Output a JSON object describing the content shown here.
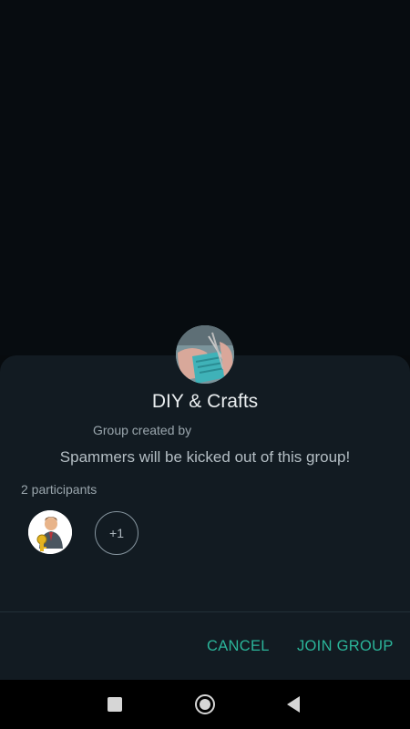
{
  "group": {
    "title": "DIY & Crafts",
    "created_by": "Group created by",
    "description": "Spammers will be kicked out of this group!",
    "participants_label": "2 participants",
    "more_participants": "+1"
  },
  "actions": {
    "cancel_label": "CANCEL",
    "join_label": "JOIN GROUP"
  },
  "colors": {
    "accent": "#2bb59a",
    "sheet_bg": "#121b22",
    "backdrop": "#070c10"
  },
  "icons": {
    "group_avatar": "knitting-photo",
    "participant_avatar": "user-with-key-avatar",
    "nav_recent": "square-icon",
    "nav_home": "circle-home-icon",
    "nav_back": "triangle-back-icon"
  }
}
